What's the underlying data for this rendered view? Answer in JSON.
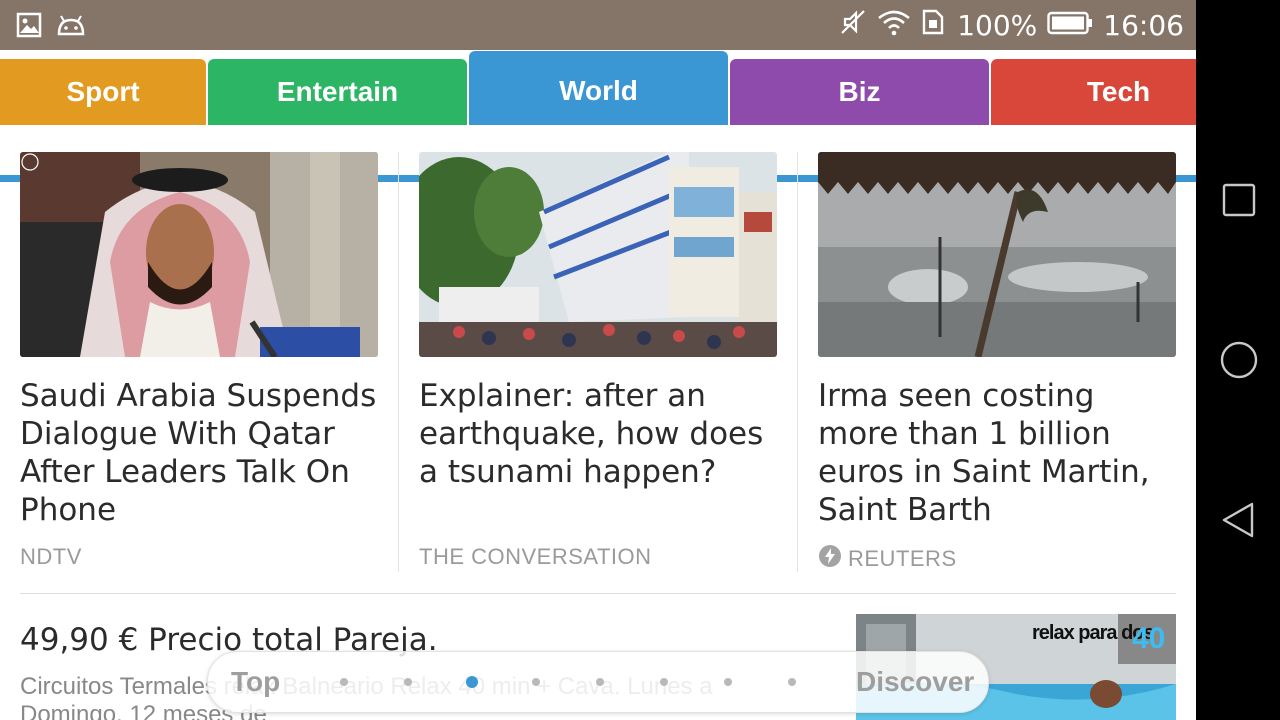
{
  "status_bar": {
    "battery": "100%",
    "time": "16:06"
  },
  "tabs": [
    {
      "label": "Sport",
      "color": "#e39a20"
    },
    {
      "label": "Entertain",
      "color": "#2cb564"
    },
    {
      "label": "World",
      "color": "#3a97d3",
      "active": true
    },
    {
      "label": "Biz",
      "color": "#8e4bab"
    },
    {
      "label": "Tech",
      "color": "#d9473b"
    }
  ],
  "articles": [
    {
      "headline": "Saudi Arabia Suspends Dialogue With Qatar After Leaders Talk On Phone",
      "source": "NDTV"
    },
    {
      "headline": "Explainer: after an earthquake, how does a tsunami happen?",
      "source": "THE CONVERSATION"
    },
    {
      "headline": "Irma seen costing more than 1 billion euros in Saint Martin, Saint Barth",
      "source": "REUTERS",
      "source_icon": "lightning-bolt-icon"
    }
  ],
  "ad": {
    "title": "49,90 € Precio total Pareja.",
    "description": "Circuitos Termales relax Balneario Relax 40 min + Cava. Lunes a Domingo. 12 meses de",
    "image_text": "relax para dos",
    "badge": "40"
  },
  "pager": {
    "left_label": "Top",
    "right_label": "Discover",
    "page_count": 8,
    "active_page": 2
  },
  "system_nav": {
    "recent": "recent-apps-icon",
    "home": "home-icon",
    "back": "back-icon"
  },
  "colors": {
    "status_bar": "#857468",
    "accent": "#3a97d3"
  }
}
